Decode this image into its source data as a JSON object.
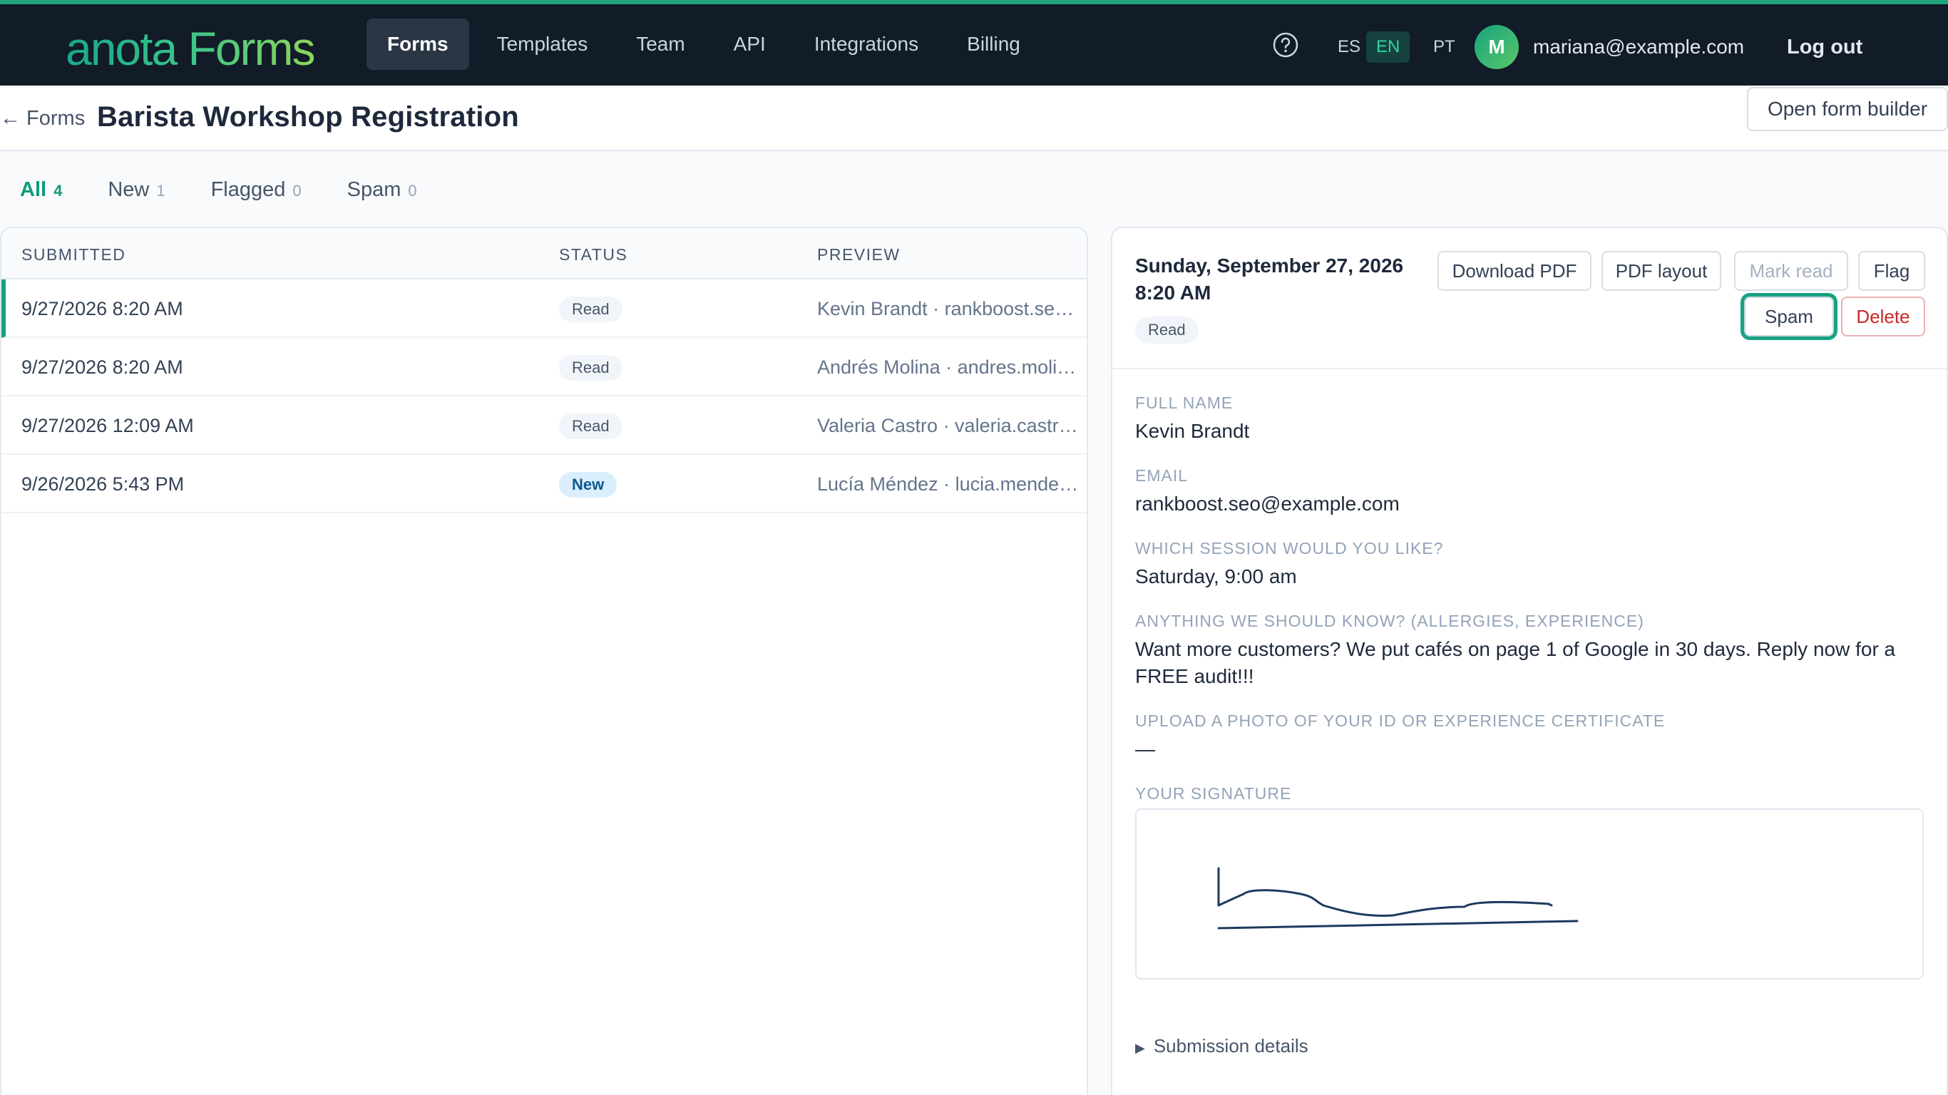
{
  "app": {
    "logo": "anota Forms",
    "nav": [
      "Forms",
      "Templates",
      "Team",
      "API",
      "Integrations",
      "Billing"
    ],
    "active_nav": "Forms",
    "languages": [
      "ES",
      "EN",
      "PT"
    ],
    "active_language": "EN",
    "user": {
      "initial": "M",
      "email": "mariana@example.com"
    },
    "logout_label": "Log out",
    "accent_color": "#13a37f",
    "nav_background": "#111c28"
  },
  "header": {
    "back_label": "← Forms",
    "title": "Barista Workshop Registration",
    "open_builder_label": "Open form builder"
  },
  "tabs": [
    {
      "label": "All",
      "count": "4",
      "active": true
    },
    {
      "label": "New",
      "count": "1"
    },
    {
      "label": "Flagged",
      "count": "0"
    },
    {
      "label": "Spam",
      "count": "0"
    }
  ],
  "list": {
    "columns": [
      "SUBMITTED",
      "STATUS",
      "PREVIEW"
    ],
    "rows": [
      {
        "submitted": "9/27/2026 8:20 AM",
        "status": "Read",
        "preview": "Kevin Brandt · rankboost.se…",
        "selected": true
      },
      {
        "submitted": "9/27/2026 8:20 AM",
        "status": "Read",
        "preview": "Andrés Molina · andres.moli…"
      },
      {
        "submitted": "9/27/2026 12:09 AM",
        "status": "Read",
        "preview": "Valeria Castro · valeria.castr…"
      },
      {
        "submitted": "9/26/2026 5:43 PM",
        "status": "New",
        "preview": "Lucía Méndez · lucia.mende…"
      }
    ]
  },
  "detail": {
    "date_line1": "Sunday, September 27, 2026",
    "date_line2": "8:20 AM",
    "status": "Read",
    "actions": {
      "download_pdf": "Download PDF",
      "pdf_layout": "PDF layout",
      "mark_read": "Mark read",
      "flag": "Flag",
      "spam": "Spam",
      "delete": "Delete"
    },
    "fields": [
      {
        "label": "FULL NAME",
        "value": "Kevin Brandt"
      },
      {
        "label": "EMAIL",
        "value": "rankboost.seo@example.com"
      },
      {
        "label": "WHICH SESSION WOULD YOU LIKE?",
        "value": "Saturday, 9:00 am"
      },
      {
        "label": "ANYTHING WE SHOULD KNOW? (ALLERGIES, EXPERIENCE)",
        "value": "Want more customers? We put cafés on page 1 of Google in 30 days. Reply now for a FREE audit!!!"
      },
      {
        "label": "UPLOAD A PHOTO OF YOUR ID OR EXPERIENCE CERTIFICATE",
        "value": "—"
      }
    ],
    "signature_label": "YOUR SIGNATURE",
    "submission_details_label": "Submission details"
  }
}
